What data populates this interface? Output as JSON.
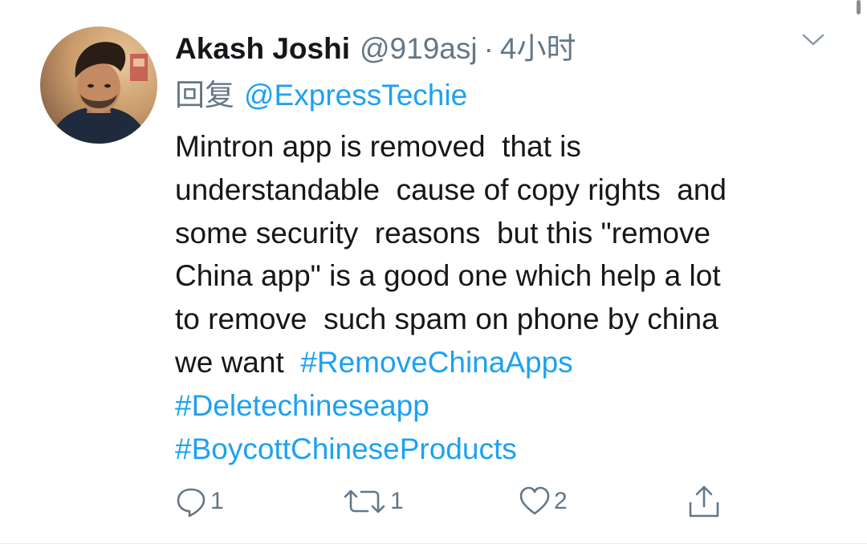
{
  "tweet": {
    "author": {
      "name": "Akash Joshi",
      "handle": "@919asj",
      "separator": "·",
      "time": "4小时"
    },
    "reply": {
      "prefix": "回复",
      "mention": "@ExpressTechie"
    },
    "body_lines": [
      "Mintron app is removed  that is",
      "understandable  cause of copy rights  and",
      "some security  reasons  but this \"remove",
      "China app\" is a good one which help a lot",
      "to remove  such spam on phone by china",
      "we want  "
    ],
    "hashtags": [
      "#RemoveChinaApps",
      "#Deletechineseapp",
      "#BoycottChineseProducts"
    ],
    "actions": {
      "reply_count": "1",
      "retweet_count": "1",
      "like_count": "2"
    }
  },
  "icons": {
    "reply": "comment-icon",
    "retweet": "retweet-icon",
    "like": "heart-icon",
    "share": "share-icon",
    "menu": "chevron-down-icon"
  },
  "colors": {
    "text_primary": "#14171a",
    "text_secondary": "#657786",
    "link": "#1da1f2",
    "background": "#ffffff"
  }
}
